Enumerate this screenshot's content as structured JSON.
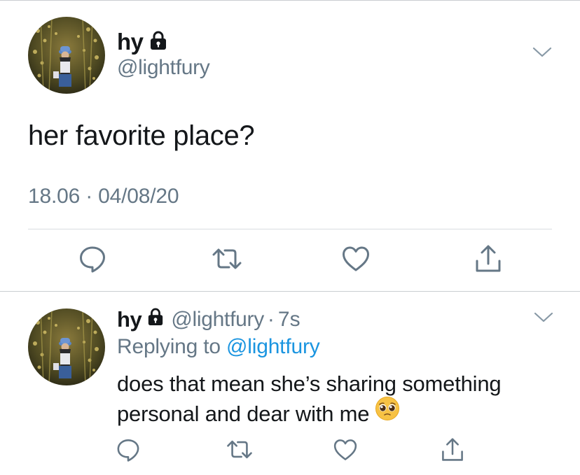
{
  "tweet": {
    "author": {
      "display_name": "hy",
      "handle": "@lightfury",
      "locked": true,
      "avatar": "profile-photo"
    },
    "text": "her favorite place?",
    "time": "18.06",
    "date": "04/08/20",
    "meta_separator": "·",
    "actions": [
      "reply-icon",
      "retweet-icon",
      "like-icon",
      "share-icon"
    ]
  },
  "reply": {
    "author": {
      "display_name": "hy",
      "handle": "@lightfury",
      "locked": true
    },
    "separator": "·",
    "time_ago": "7s",
    "replying_prefix": "Replying to",
    "replying_handle": "@lightfury",
    "text_line1": "does that mean she’s sharing something",
    "text_line2": "personal and dear with me",
    "emoji": "pleading-face-emoji",
    "actions": [
      "reply-icon",
      "retweet-icon",
      "like-icon",
      "share-icon"
    ]
  },
  "colors": {
    "text": "#14171a",
    "secondary": "#657786",
    "link": "#1b95e0",
    "divider": "#d9dde1"
  }
}
